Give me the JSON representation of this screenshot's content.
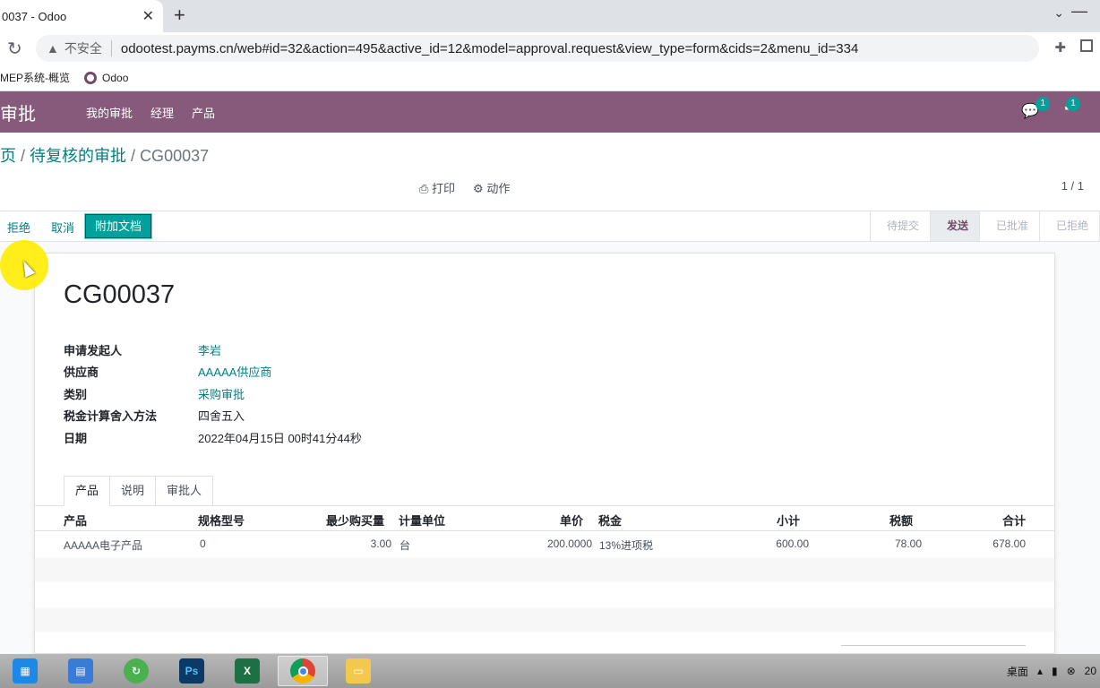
{
  "browser": {
    "tab_title": "0037 - Odoo",
    "insecure_label": "不安全",
    "url": "odootest.payms.cn/web#id=32&action=495&active_id=12&model=approval.request&view_type=form&cids=2&menu_id=334",
    "bookmarks": [
      "MEP系统-概览",
      "Odoo"
    ]
  },
  "navbar": {
    "app_name": "审批",
    "menus": [
      "我的审批",
      "经理",
      "产品"
    ],
    "messages_count": "1",
    "activities_count": "1"
  },
  "control": {
    "breadcrumb_prev_cut": "页",
    "breadcrumb_parent": "待复核的审批",
    "breadcrumb_current": "CG00037",
    "print_label": "打印",
    "action_label": "动作",
    "pager": "1 / 1"
  },
  "statusbar": {
    "reject_label": "拒绝",
    "cancel_label": "取消",
    "attach_label": "附加文档",
    "stages": [
      "待提交",
      "发送",
      "已批准",
      "已拒绝"
    ],
    "active_stage": "发送"
  },
  "form": {
    "name": "CG00037",
    "fields": [
      {
        "label": "申请发起人",
        "value": "李岩",
        "link": true
      },
      {
        "label": "供应商",
        "value": "AAAAA供应商",
        "link": true
      },
      {
        "label": "类别",
        "value": "采购审批",
        "link": true
      },
      {
        "label": "税金计算舍入方法",
        "value": "四舍五入",
        "link": false
      },
      {
        "label": "日期",
        "value": "2022年04月15日 00时41分44秒",
        "link": false
      }
    ],
    "tabs": [
      "产品",
      "说明",
      "审批人"
    ],
    "columns": [
      "产品",
      "规格型号",
      "最少购买量",
      "计量单位",
      "单价",
      "税金",
      "小计",
      "税额",
      "合计"
    ],
    "rows": [
      [
        "AAAAA电子产品",
        "0",
        "3.00",
        "台",
        "200.0000",
        "13%进项税",
        "600.00",
        "78.00",
        "678.00"
      ]
    ]
  },
  "taskbar": {
    "tray_desktop": "桌面",
    "clock_fragment": "20"
  }
}
